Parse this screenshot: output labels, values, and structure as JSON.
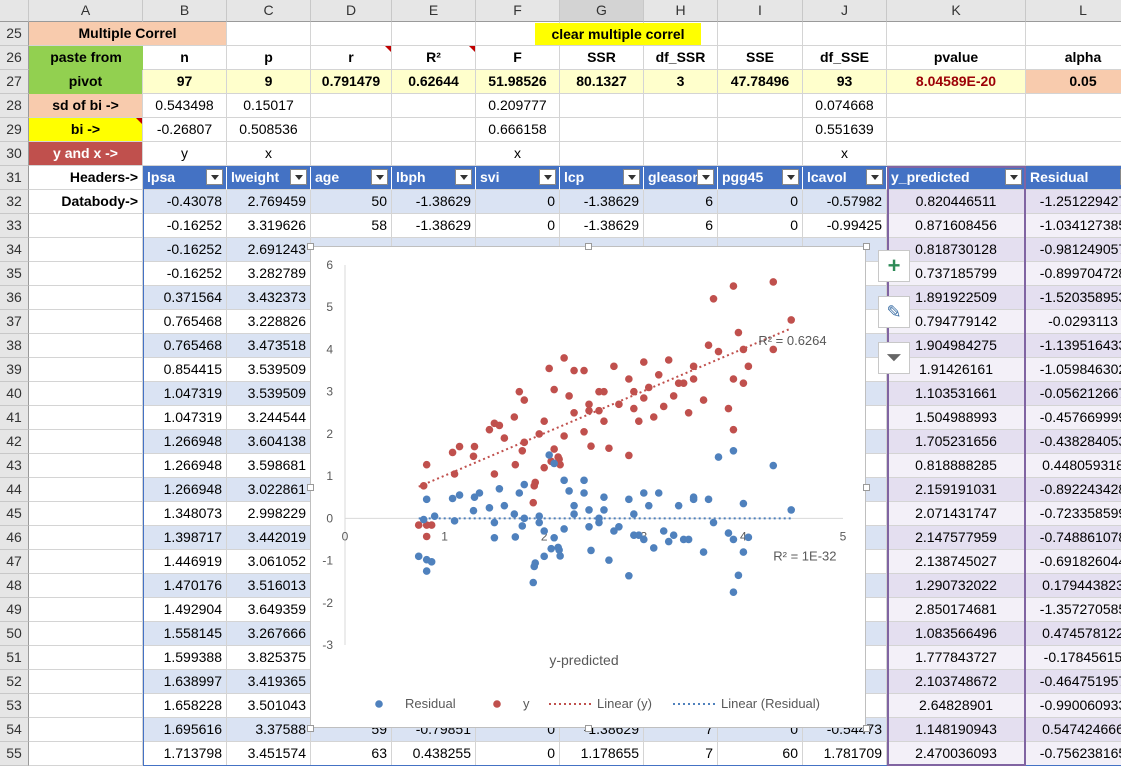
{
  "columns": [
    "A",
    "B",
    "C",
    "D",
    "E",
    "F",
    "G",
    "H",
    "I",
    "J",
    "K",
    "L"
  ],
  "rows": [
    "25",
    "26",
    "27",
    "28",
    "29",
    "30",
    "31",
    "32",
    "33",
    "34",
    "35",
    "36",
    "37",
    "38",
    "39",
    "40",
    "41",
    "42",
    "43",
    "44",
    "45",
    "46",
    "47",
    "48",
    "49",
    "50",
    "51",
    "52",
    "53",
    "54",
    "55"
  ],
  "row25": {
    "title": "Multiple Correl",
    "clear_button": "clear multiple correl"
  },
  "row26": {
    "paste": "paste from",
    "labels": [
      "n",
      "p",
      "r",
      "R²",
      "F",
      "SSR",
      "df_SSR",
      "SSE",
      "df_SSE",
      "pvalue",
      "alpha"
    ]
  },
  "row27": {
    "paste": "pivot",
    "values": [
      "97",
      "9",
      "0.791479",
      "0.62644",
      "51.98526",
      "80.1327",
      "3",
      "47.78496",
      "93",
      "8.04589E-20",
      "0.05"
    ]
  },
  "row28": {
    "label": "sd of bi ->",
    "b": "0.543498",
    "c": "0.15017",
    "f": "0.209777",
    "j": "0.074668"
  },
  "row29": {
    "label": "bi ->",
    "b": "-0.26807",
    "c": "0.508536",
    "f": "0.666158",
    "j": "0.551639"
  },
  "row30": {
    "label": "y and x ->",
    "b": "y",
    "c": "x",
    "f": "x",
    "j": "x"
  },
  "row31": {
    "label": "Headers->",
    "headers": [
      "lpsa",
      "lweight",
      "age",
      "lbph",
      "svi",
      "lcp",
      "gleason",
      "pgg45",
      "lcavol",
      "y_predicted",
      "Residual"
    ]
  },
  "row32_label": "Databody->",
  "table_rows": [
    [
      "-0.43078",
      "2.769459",
      "50",
      "-1.38629",
      "0",
      "-1.38629",
      "6",
      "0",
      "-0.57982",
      "0.820446511",
      "-1.251229427"
    ],
    [
      "-0.16252",
      "3.319626",
      "58",
      "-1.38629",
      "0",
      "-1.38629",
      "6",
      "0",
      "-0.99425",
      "0.871608456",
      "-1.034127385"
    ],
    [
      "-0.16252",
      "2.691243",
      "",
      "",
      "",
      "",
      "",
      "",
      "",
      "0.818730128",
      "-0.981249057"
    ],
    [
      "-0.16252",
      "3.282789",
      "",
      "",
      "",
      "",
      "",
      "",
      "",
      "0.737185799",
      "-0.899704728"
    ],
    [
      "0.371564",
      "3.432373",
      "",
      "",
      "",
      "",
      "",
      "",
      "",
      "1.891922509",
      "-1.520358953"
    ],
    [
      "0.765468",
      "3.228826",
      "",
      "",
      "",
      "",
      "",
      "",
      "",
      "0.794779142",
      "-0.0293113"
    ],
    [
      "0.765468",
      "3.473518",
      "",
      "",
      "",
      "",
      "",
      "",
      "",
      "1.904984275",
      "-1.139516433"
    ],
    [
      "0.854415",
      "3.539509",
      "",
      "",
      "",
      "",
      "",
      "",
      "",
      "1.91426161",
      "-1.059846302"
    ],
    [
      "1.047319",
      "3.539509",
      "",
      "",
      "",
      "",
      "",
      "",
      "",
      "1.103531661",
      "-0.056212667"
    ],
    [
      "1.047319",
      "3.244544",
      "",
      "",
      "",
      "",
      "",
      "",
      "",
      "1.504988993",
      "-0.457669999"
    ],
    [
      "1.266948",
      "3.604138",
      "",
      "",
      "",
      "",
      "",
      "",
      "",
      "1.705231656",
      "-0.438284053"
    ],
    [
      "1.266948",
      "3.598681",
      "",
      "",
      "",
      "",
      "",
      "",
      "",
      "0.818888285",
      "0.448059318"
    ],
    [
      "1.266948",
      "3.022861",
      "",
      "",
      "",
      "",
      "",
      "",
      "",
      "2.159191031",
      "-0.892243428"
    ],
    [
      "1.348073",
      "2.998229",
      "",
      "",
      "",
      "",
      "",
      "",
      "",
      "2.071431747",
      "-0.723358599"
    ],
    [
      "1.398717",
      "3.442019",
      "",
      "",
      "",
      "",
      "",
      "",
      "",
      "2.147577959",
      "-0.748861078"
    ],
    [
      "1.446919",
      "3.061052",
      "",
      "",
      "",
      "",
      "",
      "",
      "",
      "2.138745027",
      "-0.691826044"
    ],
    [
      "1.470176",
      "3.516013",
      "",
      "",
      "",
      "",
      "",
      "",
      "",
      "1.290732022",
      "0.179443823"
    ],
    [
      "1.492904",
      "3.649359",
      "",
      "",
      "",
      "",
      "",
      "",
      "",
      "2.850174681",
      "-1.357270585"
    ],
    [
      "1.558145",
      "3.267666",
      "",
      "",
      "",
      "",
      "",
      "",
      "",
      "1.083566496",
      "0.474578122"
    ],
    [
      "1.599388",
      "3.825375",
      "",
      "",
      "",
      "",
      "",
      "",
      "",
      "1.777843727",
      "-0.17845615"
    ],
    [
      "1.638997",
      "3.419365",
      "",
      "",
      "",
      "",
      "",
      "",
      "",
      "2.103748672",
      "-0.464751957"
    ],
    [
      "1.658228",
      "3.501043",
      "",
      "",
      "",
      "",
      "",
      "",
      "",
      "2.64828901",
      "-0.990060933"
    ],
    [
      "1.695616",
      "3.37588",
      "59",
      "-0.79851",
      "0",
      "-1.38629",
      "7",
      "0",
      "-0.54473",
      "1.148190943",
      "0.547424666"
    ],
    [
      "1.713798",
      "3.451574",
      "63",
      "0.438255",
      "0",
      "1.178655",
      "7",
      "60",
      "1.781709",
      "2.470036093",
      "-0.756238165"
    ]
  ],
  "side_buttons": {
    "add": "+",
    "style": "✎",
    "filter": "⏷"
  },
  "colors": {
    "orange": "#f8cbad",
    "green": "#92d050",
    "yellow": "#ffff00",
    "lightyellow": "#ffffcc",
    "red": "#c0504d",
    "table_header": "#4472c4",
    "band": "#dae3f3",
    "series_y": "#c0504d",
    "series_residual": "#4f81bd"
  },
  "chart_data": {
    "type": "scatter",
    "xlabel": "y-predicted",
    "xlim": [
      0,
      5
    ],
    "ylim": [
      -3,
      6
    ],
    "xticks": [
      "0",
      "1",
      "2",
      "3",
      "4",
      "5"
    ],
    "yticks": [
      "-3",
      "-2",
      "-1",
      "0",
      "1",
      "2",
      "3",
      "4",
      "5",
      "6"
    ],
    "annotations": [
      "R² = 0.6264",
      "R² = 1E-32"
    ],
    "legend": [
      "Residual",
      "y",
      "Linear (y)",
      "Linear (Residual)"
    ],
    "legend_position": "bottom",
    "series": [
      {
        "name": "y",
        "points": [
          [
            0.82,
            -0.43
          ],
          [
            0.87,
            -0.16
          ],
          [
            0.82,
            -0.16
          ],
          [
            0.74,
            -0.16
          ],
          [
            1.89,
            0.37
          ],
          [
            0.79,
            0.77
          ],
          [
            1.9,
            0.77
          ],
          [
            1.91,
            0.85
          ],
          [
            1.1,
            1.05
          ],
          [
            1.5,
            1.05
          ],
          [
            1.71,
            1.27
          ],
          [
            0.82,
            1.27
          ],
          [
            2.16,
            1.27
          ],
          [
            2.07,
            1.35
          ],
          [
            2.15,
            1.4
          ],
          [
            2.14,
            1.45
          ],
          [
            1.29,
            1.47
          ],
          [
            2.85,
            1.49
          ],
          [
            1.08,
            1.56
          ],
          [
            1.78,
            1.6
          ],
          [
            2.1,
            1.64
          ],
          [
            2.65,
            1.66
          ],
          [
            1.15,
            1.7
          ],
          [
            2.47,
            1.71
          ],
          [
            1.6,
            1.9
          ],
          [
            2.2,
            1.95
          ],
          [
            1.95,
            2.0
          ],
          [
            2.4,
            2.05
          ],
          [
            1.45,
            2.1
          ],
          [
            1.55,
            2.2
          ],
          [
            2.0,
            2.3
          ],
          [
            2.6,
            2.3
          ],
          [
            1.7,
            2.4
          ],
          [
            2.3,
            2.5
          ],
          [
            2.55,
            2.55
          ],
          [
            2.9,
            2.6
          ],
          [
            3.2,
            2.65
          ],
          [
            2.45,
            2.7
          ],
          [
            2.75,
            2.7
          ],
          [
            1.8,
            2.8
          ],
          [
            3.0,
            2.85
          ],
          [
            2.25,
            2.9
          ],
          [
            3.3,
            2.9
          ],
          [
            2.6,
            3.0
          ],
          [
            3.05,
            3.1
          ],
          [
            3.6,
            2.8
          ],
          [
            1.75,
            3.0
          ],
          [
            2.1,
            3.05
          ],
          [
            3.4,
            3.2
          ],
          [
            2.85,
            3.3
          ],
          [
            3.15,
            3.4
          ],
          [
            2.4,
            3.5
          ],
          [
            2.7,
            3.6
          ],
          [
            3.5,
            3.6
          ],
          [
            3.9,
            3.3
          ],
          [
            4.0,
            3.2
          ],
          [
            2.05,
            3.55
          ],
          [
            3.0,
            3.7
          ],
          [
            3.25,
            3.75
          ],
          [
            4.05,
            3.6
          ],
          [
            2.2,
            3.8
          ],
          [
            3.75,
            3.95
          ],
          [
            4.0,
            4.0
          ],
          [
            3.65,
            4.1
          ],
          [
            4.3,
            4.0
          ],
          [
            3.95,
            4.4
          ],
          [
            3.7,
            5.2
          ],
          [
            3.9,
            5.5
          ],
          [
            4.3,
            5.6
          ],
          [
            4.48,
            4.7
          ],
          [
            2.55,
            3.0
          ],
          [
            3.1,
            2.4
          ],
          [
            3.45,
            2.5
          ],
          [
            2.3,
            3.5
          ],
          [
            1.3,
            1.7
          ],
          [
            1.8,
            1.8
          ],
          [
            2.45,
            2.55
          ],
          [
            2.9,
            3.0
          ],
          [
            3.35,
            3.2
          ],
          [
            2.0,
            1.2
          ],
          [
            2.95,
            2.3
          ],
          [
            3.85,
            2.6
          ],
          [
            3.9,
            2.1
          ],
          [
            1.5,
            2.25
          ],
          [
            3.5,
            3.3
          ]
        ]
      },
      {
        "name": "Residual",
        "points": [
          [
            0.82,
            -1.25
          ],
          [
            0.87,
            -1.03
          ],
          [
            0.82,
            -0.98
          ],
          [
            0.74,
            -0.9
          ],
          [
            1.89,
            -1.52
          ],
          [
            0.79,
            -0.03
          ],
          [
            1.9,
            -1.14
          ],
          [
            1.91,
            -1.06
          ],
          [
            1.1,
            -0.06
          ],
          [
            1.5,
            -0.46
          ],
          [
            1.71,
            -0.44
          ],
          [
            0.82,
            0.45
          ],
          [
            2.16,
            -0.89
          ],
          [
            2.07,
            -0.72
          ],
          [
            2.15,
            -0.75
          ],
          [
            2.14,
            -0.69
          ],
          [
            1.29,
            0.18
          ],
          [
            2.85,
            -1.36
          ],
          [
            1.08,
            0.47
          ],
          [
            1.78,
            -0.18
          ],
          [
            2.1,
            -0.46
          ],
          [
            2.65,
            -0.99
          ],
          [
            1.15,
            0.55
          ],
          [
            2.47,
            -0.76
          ],
          [
            1.6,
            0.3
          ],
          [
            2.2,
            -0.25
          ],
          [
            1.95,
            0.05
          ],
          [
            2.4,
            0.6
          ],
          [
            1.45,
            0.25
          ],
          [
            1.55,
            0.7
          ],
          [
            2.0,
            -0.3
          ],
          [
            2.6,
            0.5
          ],
          [
            1.7,
            0.1
          ],
          [
            2.3,
            0.3
          ],
          [
            2.55,
            -0.1
          ],
          [
            2.9,
            0.1
          ],
          [
            3.2,
            -0.3
          ],
          [
            2.45,
            -0.2
          ],
          [
            2.75,
            -0.2
          ],
          [
            1.8,
            0.8
          ],
          [
            3.0,
            -0.5
          ],
          [
            2.25,
            0.65
          ],
          [
            3.3,
            -0.4
          ],
          [
            2.6,
            0.2
          ],
          [
            3.05,
            0.3
          ],
          [
            3.6,
            -0.8
          ],
          [
            1.75,
            0.6
          ],
          [
            2.1,
            1.3
          ],
          [
            3.4,
            -0.5
          ],
          [
            2.85,
            0.45
          ],
          [
            3.15,
            0.6
          ],
          [
            2.4,
            0.9
          ],
          [
            2.7,
            -0.3
          ],
          [
            3.5,
            0.5
          ],
          [
            3.9,
            -0.5
          ],
          [
            4.0,
            -0.8
          ],
          [
            2.05,
            1.5
          ],
          [
            3.0,
            0.6
          ],
          [
            3.25,
            -0.55
          ],
          [
            4.05,
            -0.45
          ],
          [
            2.2,
            0.9
          ],
          [
            3.75,
            1.45
          ],
          [
            4.0,
            0.35
          ],
          [
            3.65,
            0.45
          ],
          [
            4.3,
            1.25
          ],
          [
            3.95,
            -1.35
          ],
          [
            3.7,
            -0.1
          ],
          [
            3.9,
            1.6
          ],
          [
            4.48,
            0.2
          ],
          [
            1.3,
            0.5
          ],
          [
            2.55,
            0.0
          ],
          [
            3.1,
            -0.7
          ],
          [
            3.45,
            -0.5
          ],
          [
            2.3,
            0.1
          ],
          [
            1.8,
            0.0
          ],
          [
            2.45,
            0.2
          ],
          [
            2.9,
            -0.4
          ],
          [
            3.35,
            0.3
          ],
          [
            2.0,
            -0.9
          ],
          [
            2.95,
            -0.4
          ],
          [
            3.85,
            -0.35
          ],
          [
            3.9,
            -1.75
          ],
          [
            1.5,
            -0.1
          ],
          [
            3.5,
            0.45
          ],
          [
            1.35,
            0.6
          ],
          [
            0.9,
            0.05
          ],
          [
            1.95,
            -0.1
          ]
        ]
      },
      {
        "name": "Linear (y)",
        "points": [
          [
            0.74,
            0.75
          ],
          [
            4.48,
            4.5
          ]
        ]
      },
      {
        "name": "Linear (Residual)",
        "points": [
          [
            0.74,
            0.0
          ],
          [
            4.48,
            0.0
          ]
        ]
      }
    ]
  }
}
